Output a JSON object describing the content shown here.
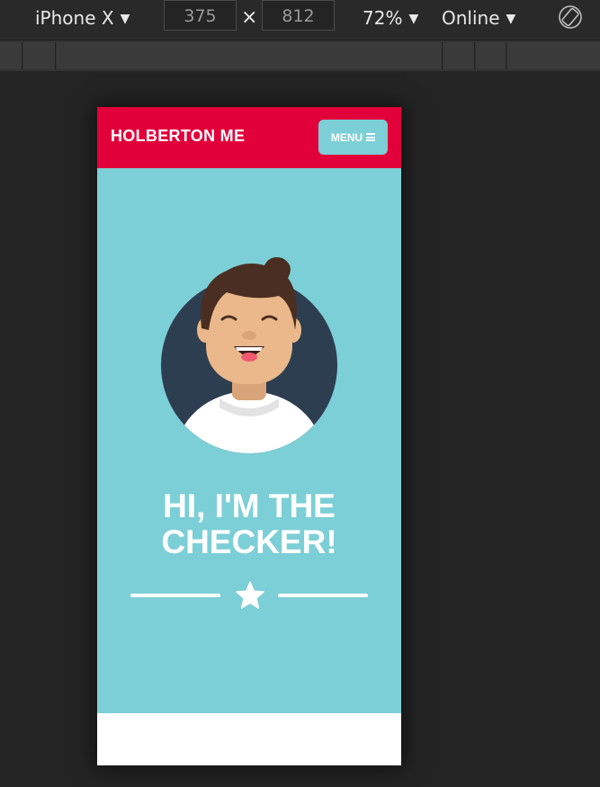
{
  "toolbar": {
    "device": "iPhone X",
    "width": "375",
    "height": "812",
    "times": "×",
    "zoom": "72%",
    "network": "Online",
    "caret": "▼",
    "rotate_icon": "rotate-icon"
  },
  "site": {
    "brand": "HOLBERTON ME",
    "menu_label": "MENU",
    "menu_icon": "hamburger-icon",
    "title_line1": "HI, I'M THE",
    "title_line2": "CHECKER!",
    "divider_icon": "star-icon"
  },
  "colors": {
    "header_bg": "#e2003b",
    "hero_bg": "#7ccfd6",
    "avatar_circle": "#2d3e50",
    "text": "#ffffff"
  }
}
